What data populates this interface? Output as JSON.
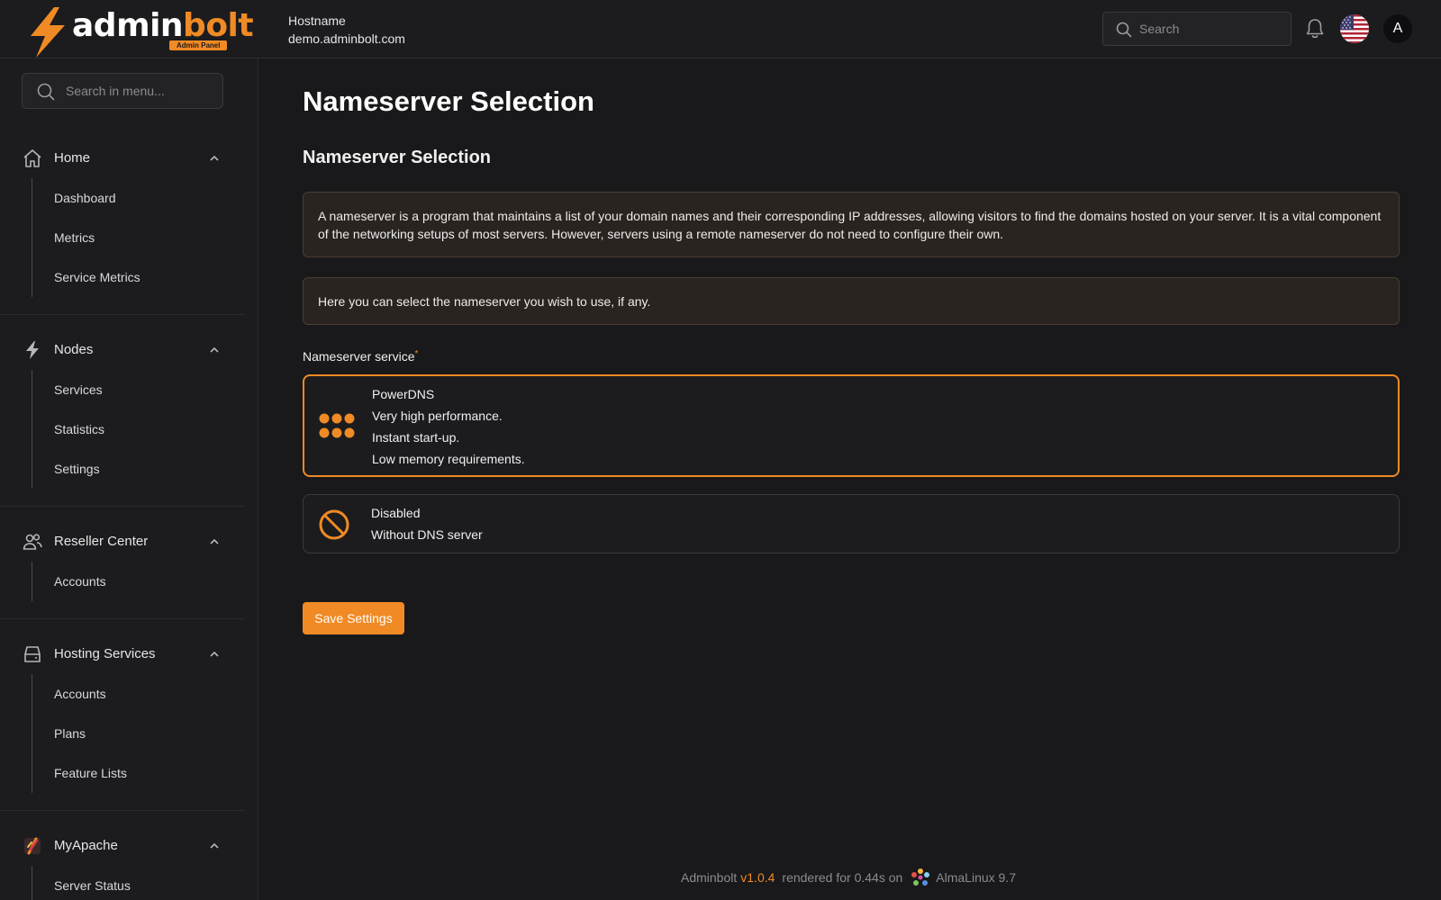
{
  "header": {
    "logo_primary": "admin",
    "logo_accent": "bolt",
    "logo_badge": "Admin Panel",
    "hostname_label": "Hostname",
    "hostname_value": "demo.adminbolt.com",
    "search_placeholder": "Search",
    "avatar_letter": "A"
  },
  "sidebar": {
    "search_placeholder": "Search in menu...",
    "groups": [
      {
        "label": "Home",
        "icon": "home-icon",
        "items": [
          "Dashboard",
          "Metrics",
          "Service Metrics"
        ]
      },
      {
        "label": "Nodes",
        "icon": "bolt-icon",
        "items": [
          "Services",
          "Statistics",
          "Settings"
        ]
      },
      {
        "label": "Reseller Center",
        "icon": "users-icon",
        "items": [
          "Accounts"
        ]
      },
      {
        "label": "Hosting Services",
        "icon": "server-icon",
        "items": [
          "Accounts",
          "Plans",
          "Feature Lists"
        ]
      },
      {
        "label": "MyApache",
        "icon": "apache-feather-icon",
        "items": [
          "Server Status"
        ]
      }
    ]
  },
  "main": {
    "page_title": "Nameserver Selection",
    "section_title": "Nameserver Selection",
    "info_1": "A nameserver is a program that maintains a list of your domain names and their corresponding IP addresses, allowing visitors to find the domains hosted on your server. It is a vital component of the networking setups of most servers. However, servers using a remote nameserver do not need to configure their own.",
    "info_2": "Here you can select the nameserver you wish to use, if any.",
    "field_label": "Nameserver service",
    "required_mark": "*",
    "options": [
      {
        "name": "PowerDNS",
        "lines": [
          "Very high performance.",
          "Instant start-up.",
          "Low memory requirements."
        ],
        "icon": "powerdns-dots-icon",
        "selected": true
      },
      {
        "name": "Disabled",
        "lines": [
          "Without DNS server"
        ],
        "icon": "disabled-icon",
        "selected": false
      }
    ],
    "save_label": "Save Settings"
  },
  "footer": {
    "app_name": "Adminbolt",
    "version": "v1.0.4",
    "render_text": "rendered for 0.44s on",
    "os": "AlmaLinux 9.7"
  },
  "colors": {
    "accent": "#f08a24",
    "background": "#19191b",
    "sidebar": "#1c1c1f",
    "info_box": "#2a2420"
  }
}
